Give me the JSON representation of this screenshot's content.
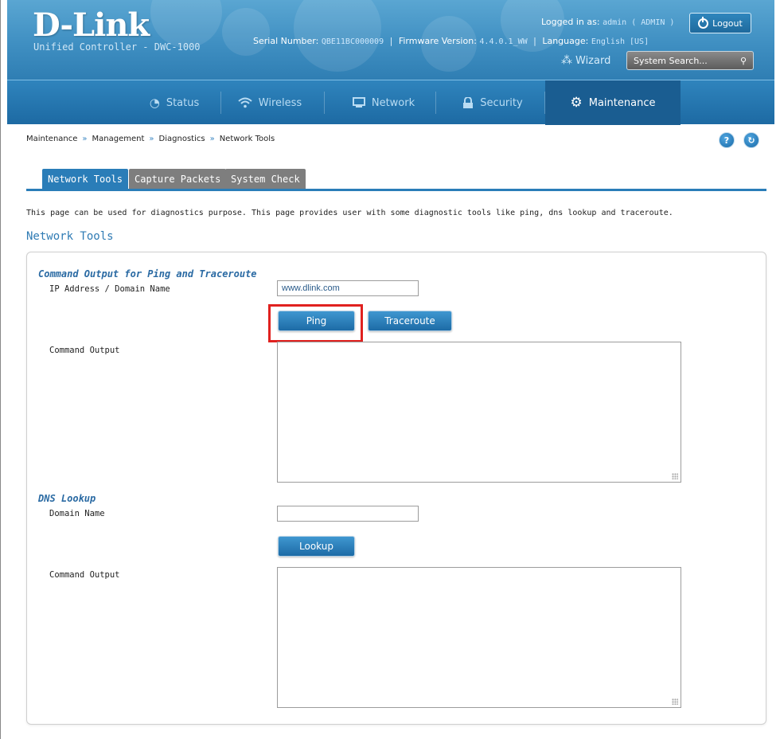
{
  "header": {
    "brand": "D-Link",
    "product": "Unified Controller - DWC-1000",
    "logged_in_label": "Logged in as:",
    "logged_in_value": "admin ( ADMIN )",
    "logout_label": "Logout",
    "serial_label": "Serial Number:",
    "serial_value": "QBE11BC000009",
    "firmware_label": "Firmware Version:",
    "firmware_value": "4.4.0.1_WW",
    "language_label": "Language:",
    "language_value": "English [US]",
    "wizard_label": "Wizard",
    "search_placeholder": "System Search..."
  },
  "nav": {
    "items": [
      {
        "label": "Status",
        "icon": "gauge-icon"
      },
      {
        "label": "Wireless",
        "icon": "wifi-icon"
      },
      {
        "label": "Network",
        "icon": "monitor-icon"
      },
      {
        "label": "Security",
        "icon": "lock-icon"
      },
      {
        "label": "Maintenance",
        "icon": "gears-icon",
        "active": true
      }
    ]
  },
  "breadcrumb": {
    "items": [
      "Maintenance",
      "Management",
      "Diagnostics",
      "Network Tools"
    ],
    "separator": "»"
  },
  "help_icons": [
    "?",
    "↻"
  ],
  "tabs": [
    {
      "label": "Network Tools",
      "active": true
    },
    {
      "label": "Capture Packets",
      "active": false
    },
    {
      "label": "System Check",
      "active": false
    }
  ],
  "description": "This page can be used for diagnostics purpose. This page provides user with some diagnostic tools like ping, dns lookup and traceroute.",
  "section_title": "Network Tools",
  "ping": {
    "group_title": "Command Output for Ping and Traceroute",
    "ip_label": "IP Address / Domain Name",
    "ip_value": "www.dlink.com",
    "ping_label": "Ping",
    "traceroute_label": "Traceroute",
    "output_label": "Command Output"
  },
  "dns": {
    "group_title": "DNS Lookup",
    "domain_label": "Domain Name",
    "domain_value": "",
    "lookup_label": "Lookup",
    "output_label": "Command Output"
  },
  "colors": {
    "accent": "#2a7db8",
    "highlight": "#e0211f"
  }
}
